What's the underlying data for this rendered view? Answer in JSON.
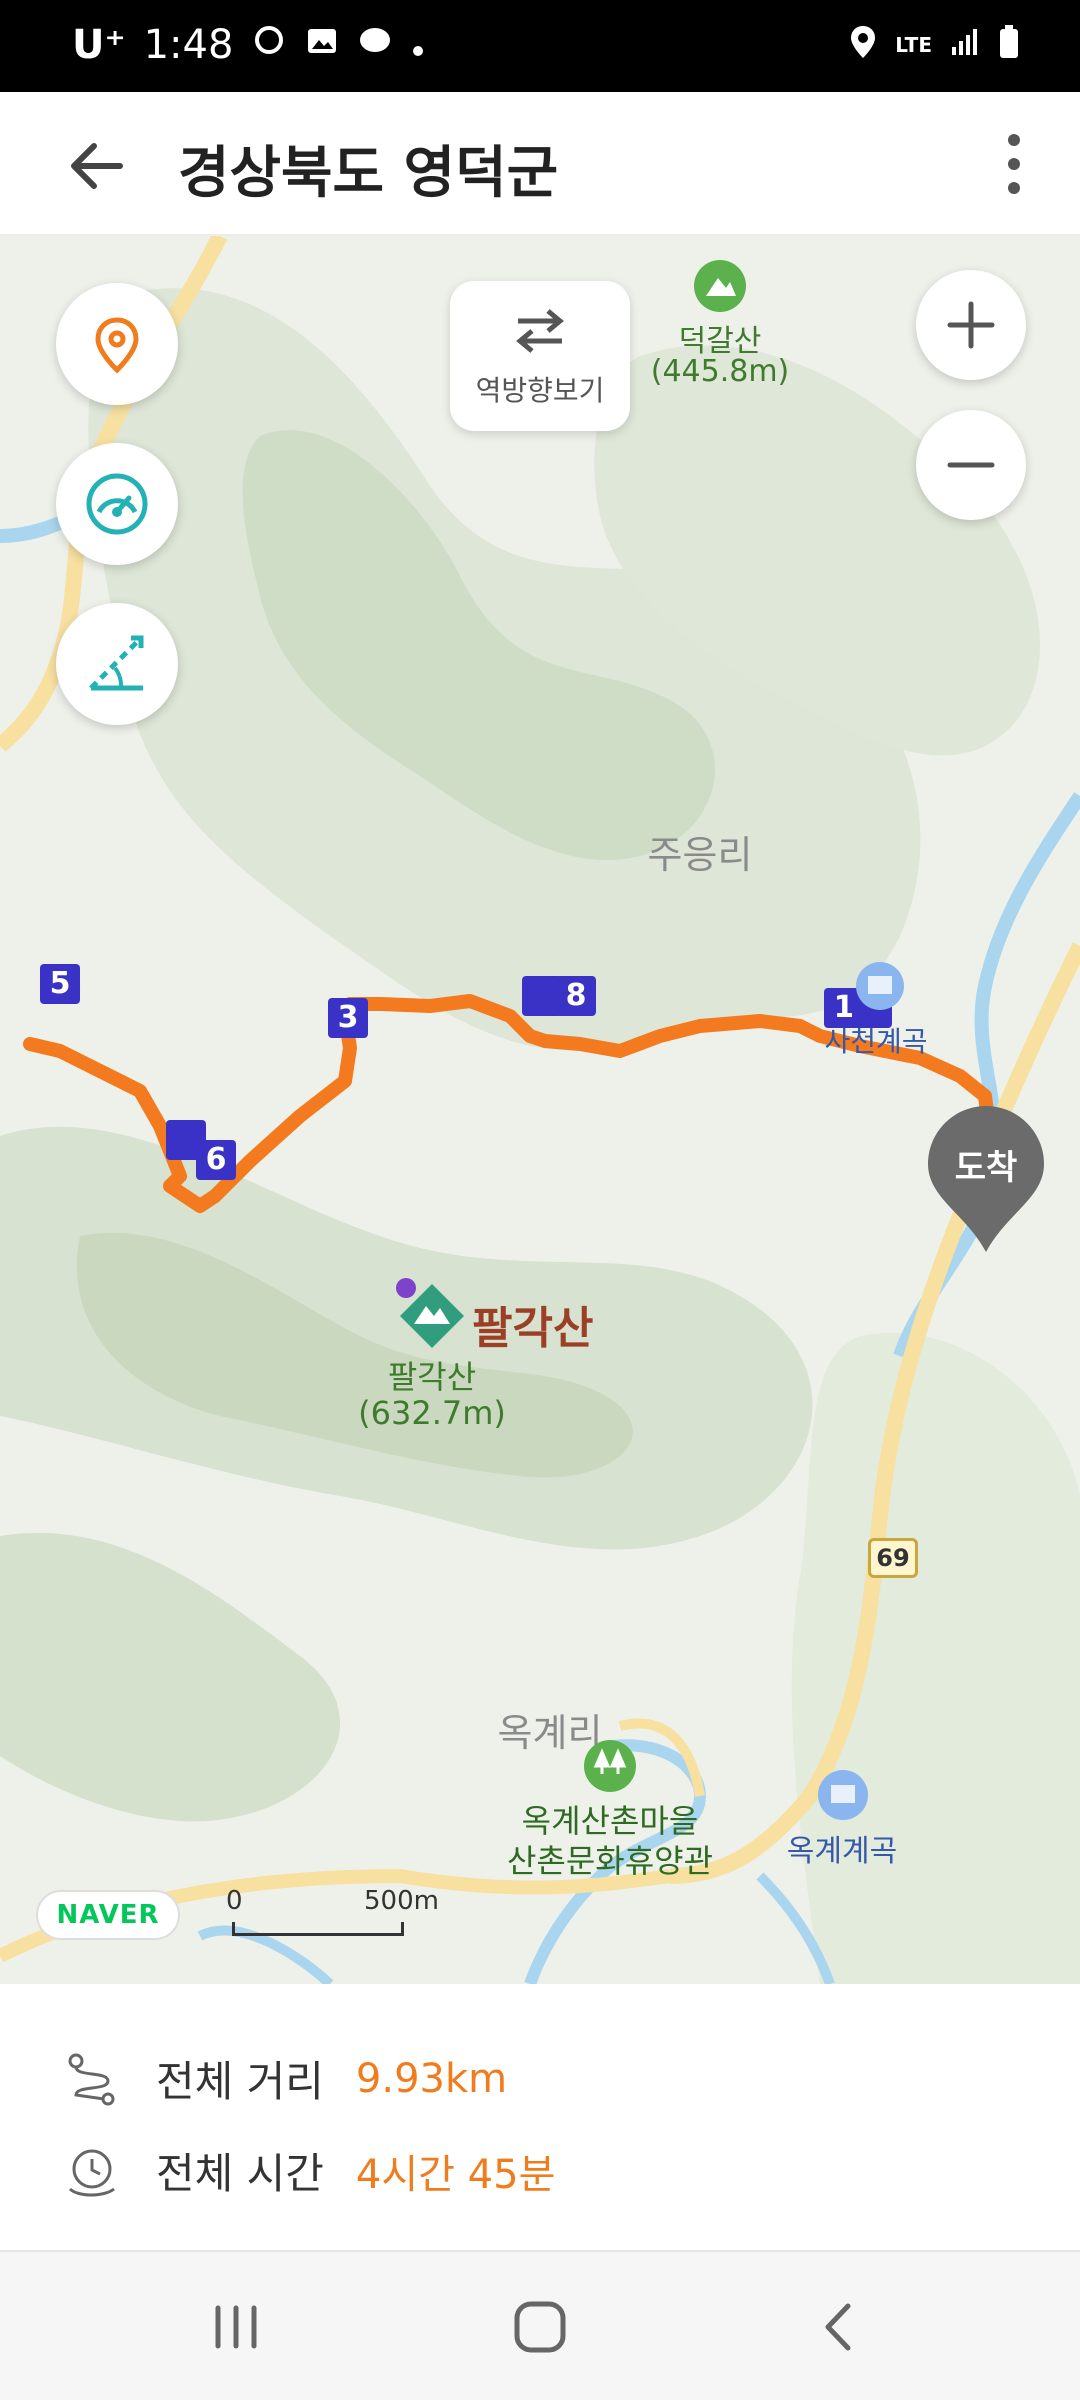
{
  "status_bar": {
    "carrier": "U⁺",
    "time": "1:48",
    "network": "LTE"
  },
  "header": {
    "title": "경상북도 영덕군"
  },
  "map": {
    "reverse_button_label": "역방향보기",
    "places": {
      "peak_north_name": "덕갈산",
      "peak_north_height": "(445.8m)",
      "village_jueungri": "주응리",
      "valley_1": "사천계곡",
      "peak_main_title": "팔각산",
      "peak_main_name": "팔각산",
      "peak_main_height": "(632.7m)",
      "village_okgyeri": "옥계리",
      "rest_area_line1": "옥계산촌마을",
      "rest_area_line2": "산촌문화휴양관",
      "valley_2": "옥계계곡",
      "road_number": "69"
    },
    "arrival_label": "도착",
    "route_markers": [
      "1",
      "3",
      "5",
      "6",
      "8"
    ],
    "naver_logo": "NAVER",
    "scale": {
      "zero": "0",
      "distance": "500m"
    },
    "colors": {
      "route": "#f47a20",
      "marker": "#3a32c6",
      "road": "#f7e0a0",
      "water": "#a9d5ee"
    }
  },
  "summary": {
    "distance_label": "전체 거리",
    "distance_value": "9.93km",
    "time_label": "전체 시간",
    "time_value": "4시간 45분"
  }
}
